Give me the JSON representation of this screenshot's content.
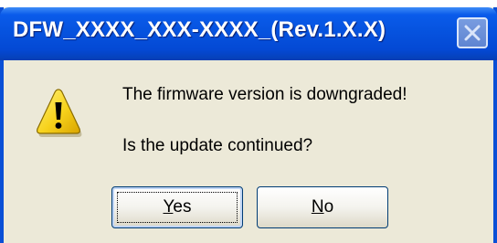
{
  "dialog": {
    "title": "DFW_XXXX_XXX-XXXX_(Rev.1.X.X)",
    "message": "The firmware version is downgraded!",
    "question": "Is the update continued?",
    "icon": "warning-icon",
    "buttons": {
      "yes": {
        "mnemonic": "Y",
        "rest": "es"
      },
      "no": {
        "mnemonic": "N",
        "rest": "o"
      }
    }
  },
  "colors": {
    "title_bar": "#0653df",
    "dialog_face": "#ece9d8",
    "warning_yellow": "#f7d21c"
  }
}
